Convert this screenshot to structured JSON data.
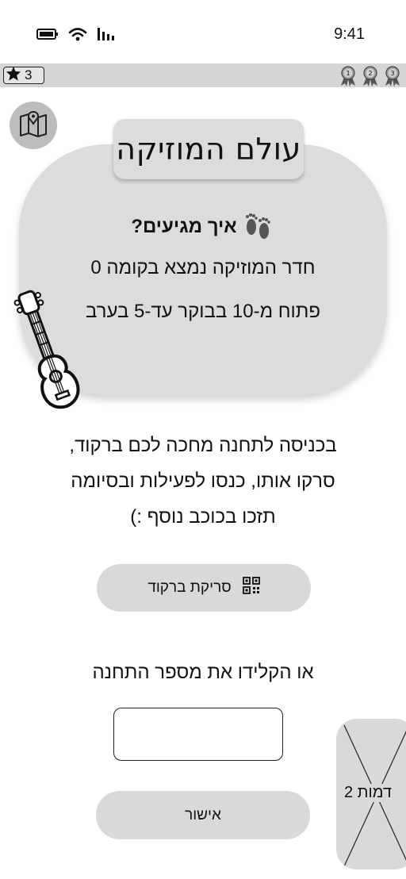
{
  "status_bar": {
    "time": "9:41"
  },
  "progress": {
    "stars": "3",
    "medals": [
      "1",
      "2",
      "3"
    ]
  },
  "station": {
    "title": "עולם המוזיקה",
    "how_to_get": "איך מגיעים?",
    "location": "חדר המוזיקה נמצא בקומה 0",
    "hours": "פתוח מ-10 בבוקר עד-5 בערב"
  },
  "instructions": {
    "line1": "בכניסה לתחנה מחכה לכם ברקוד,",
    "line2": "סרקו אותו, כנסו לפעילות ובסיומה",
    "line3": "תזכו בכוכב נוסף :)"
  },
  "scan_button": {
    "label": "סריקת ברקוד"
  },
  "manual_entry": {
    "label": "או הקלידו את מספר התחנה",
    "value": ""
  },
  "confirm_button": {
    "label": "אישור"
  },
  "character": {
    "label": "דמות 2"
  },
  "icons": [
    "battery-icon",
    "wifi-icon",
    "signal-icon",
    "star-icon",
    "medal-icon",
    "map-icon",
    "footprints-icon",
    "guitar-icon",
    "qr-code-icon"
  ]
}
